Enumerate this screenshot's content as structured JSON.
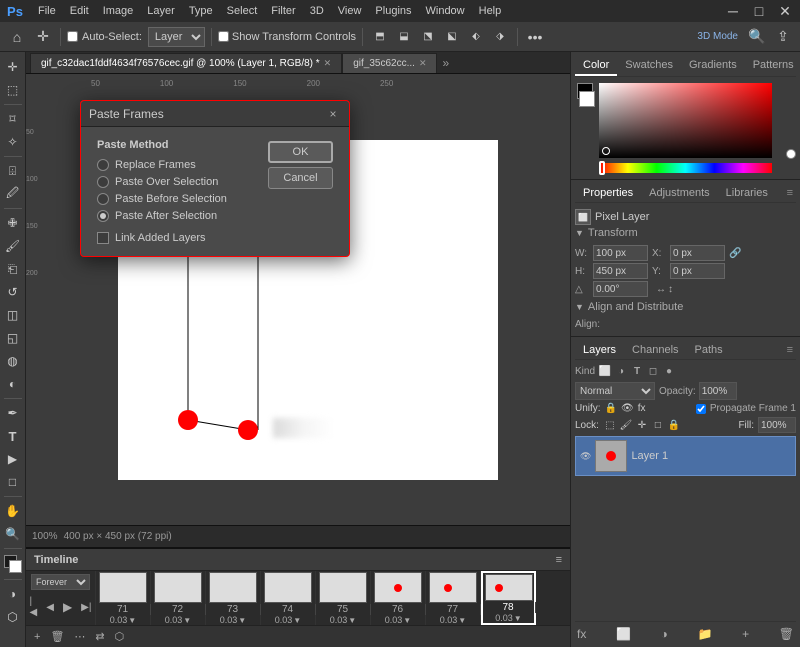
{
  "app": {
    "title": "Adobe Photoshop"
  },
  "menubar": {
    "logo": "Ps",
    "items": [
      "File",
      "Edit",
      "Image",
      "Layer",
      "Type",
      "Select",
      "Filter",
      "3D",
      "View",
      "Plugins",
      "Window",
      "Help"
    ]
  },
  "toolbar": {
    "autoselect_label": "Auto-Select:",
    "autoselect_value": "Layer",
    "show_transform": "Show Transform Controls",
    "three_d_label": "3D Mode",
    "search_placeholder": "Search"
  },
  "tabs": [
    {
      "label": "gif_c32dac1fddf4634f76576cec.gif @ 100% (Layer 1, RGB/8) *",
      "active": true
    },
    {
      "label": "gif_35c62cc...",
      "active": false
    }
  ],
  "canvas": {
    "zoom": "100%",
    "dimensions": "400 px × 450 px (72 ppi)"
  },
  "color_panel": {
    "tabs": [
      "Color",
      "Swatches",
      "Gradients",
      "Patterns"
    ],
    "active_tab": "Color"
  },
  "properties_panel": {
    "tabs": [
      "Properties",
      "Adjustments",
      "Libraries"
    ],
    "active_tab": "Properties",
    "pixel_layer_label": "Pixel Layer",
    "transform_label": "Transform",
    "w_label": "W",
    "h_label": "H",
    "x_label": "X",
    "y_label": "Y",
    "w_value": "100 px",
    "h_value": "450 px",
    "x_value": "0 px",
    "y_value": "0 px",
    "angle_value": "0.00°",
    "align_label": "Align and Distribute",
    "align_sub": "Align:"
  },
  "layers_panel": {
    "tabs": [
      "Layers",
      "Channels",
      "Paths"
    ],
    "active_tab": "Layers",
    "kind_label": "Kind",
    "blend_mode": "Normal",
    "opacity_label": "Opacity:",
    "opacity_value": "100%",
    "unify_label": "Unify:",
    "lock_label": "Lock:",
    "fill_label": "Fill:",
    "fill_value": "100%",
    "propagate_label": "Propagate Frame 1",
    "layers": [
      {
        "name": "Layer 1",
        "active": true
      }
    ],
    "footer_buttons": [
      "fx",
      "add-mask",
      "new-fill",
      "new-layer",
      "delete"
    ]
  },
  "timeline": {
    "title": "Timeline",
    "loop_label": "Forever",
    "frames": [
      {
        "num": "71",
        "duration": "0.03"
      },
      {
        "num": "72",
        "duration": "0.03"
      },
      {
        "num": "73",
        "duration": "0.03"
      },
      {
        "num": "74",
        "duration": "0.03"
      },
      {
        "num": "75",
        "duration": "0.03"
      },
      {
        "num": "76",
        "duration": "0.03"
      },
      {
        "num": "77",
        "duration": "0.03"
      },
      {
        "num": "78",
        "duration": "0.03",
        "active": true
      }
    ]
  },
  "dialog": {
    "title": "Paste Frames",
    "close_label": "×",
    "section_label": "Paste Method",
    "options": [
      {
        "label": "Replace Frames",
        "selected": false
      },
      {
        "label": "Paste Over Selection",
        "selected": false
      },
      {
        "label": "Paste Before Selection",
        "selected": false
      },
      {
        "label": "Paste After Selection",
        "selected": true
      }
    ],
    "checkbox_label": "Link Added Layers",
    "checkbox_checked": false,
    "ok_label": "OK",
    "cancel_label": "Cancel"
  }
}
